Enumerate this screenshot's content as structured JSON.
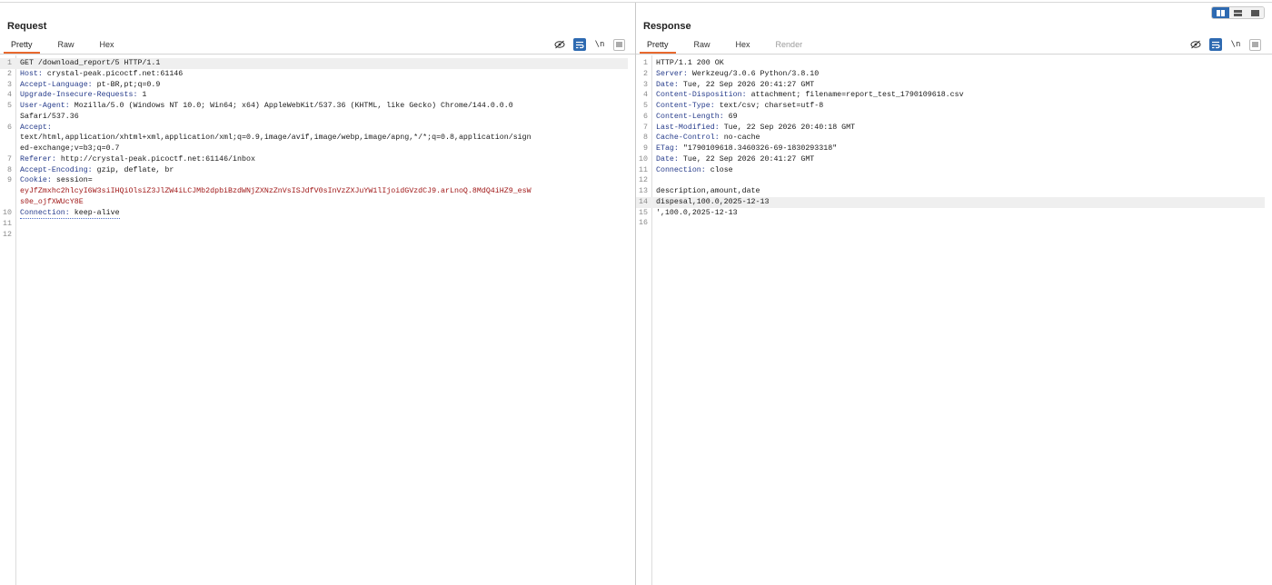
{
  "request": {
    "title": "Request",
    "tabs": [
      "Pretty",
      "Raw",
      "Hex"
    ],
    "lines": [
      {
        "num": "1",
        "text": "GET /download_report/5 HTTP/1.1"
      },
      {
        "num": "2",
        "key": "Host:",
        "value": " crystal-peak.picoctf.net:61146"
      },
      {
        "num": "3",
        "key": "Accept-Language:",
        "value": " pt-BR,pt;q=0.9"
      },
      {
        "num": "4",
        "key": "Upgrade-Insecure-Requests:",
        "value": " 1"
      },
      {
        "num": "5",
        "key": "User-Agent:",
        "value": " Mozilla/5.0 (Windows NT 10.0; Win64; x64) AppleWebKit/537.36 (KHTML, like Gecko) Chrome/144.0.0.0"
      },
      {
        "num": "",
        "text": "Safari/537.36"
      },
      {
        "num": "6",
        "key": "Accept:",
        "value": ""
      },
      {
        "num": "",
        "text": "text/html,application/xhtml+xml,application/xml;q=0.9,image/avif,image/webp,image/apng,*/*;q=0.8,application/sign"
      },
      {
        "num": "",
        "text": "ed-exchange;v=b3;q=0.7"
      },
      {
        "num": "7",
        "key": "Referer:",
        "value": " http://crystal-peak.picoctf.net:61146/inbox"
      },
      {
        "num": "8",
        "key": "Accept-Encoding:",
        "value": " gzip, deflate, br"
      },
      {
        "num": "9",
        "key": "Cookie:",
        "value": " session="
      },
      {
        "num": "",
        "red": "eyJfZmxhc2hlcyI6W3siIHQiOlsiZ3JlZW4iLCJMb2dpbiBzdWNjZXNzZnVsISJdfV0sInVzZXJuYW1lIjoidGVzdCJ9.arLnoQ.8MdQ4iHZ9_esW"
      },
      {
        "num": "",
        "red": "s0e_ojfXWUcY8E"
      },
      {
        "num": "10",
        "key": "Connection:",
        "value": " keep-alive"
      },
      {
        "num": "11",
        "text": ""
      },
      {
        "num": "12",
        "text": ""
      }
    ]
  },
  "response": {
    "title": "Response",
    "tabs": [
      "Pretty",
      "Raw",
      "Hex",
      "Render"
    ],
    "lines": [
      {
        "num": "1",
        "text": "HTTP/1.1 200 OK"
      },
      {
        "num": "2",
        "key": "Server:",
        "value": " Werkzeug/3.0.6 Python/3.8.10"
      },
      {
        "num": "3",
        "key": "Date:",
        "value": " Tue, 22 Sep 2026 20:41:27 GMT"
      },
      {
        "num": "4",
        "key": "Content-Disposition:",
        "value": " attachment; filename=report_test_1790109618.csv"
      },
      {
        "num": "5",
        "key": "Content-Type:",
        "value": " text/csv; charset=utf-8"
      },
      {
        "num": "6",
        "key": "Content-Length:",
        "value": " 69"
      },
      {
        "num": "7",
        "key": "Last-Modified:",
        "value": " Tue, 22 Sep 2026 20:40:18 GMT"
      },
      {
        "num": "8",
        "key": "Cache-Control:",
        "value": " no-cache"
      },
      {
        "num": "9",
        "key": "ETag:",
        "value": " \"1790109618.3460326-69-1830293318\""
      },
      {
        "num": "10",
        "key": "Date:",
        "value": " Tue, 22 Sep 2026 20:41:27 GMT"
      },
      {
        "num": "11",
        "key": "Connection:",
        "value": " close"
      },
      {
        "num": "12",
        "text": ""
      },
      {
        "num": "13",
        "text": "description,amount,date"
      },
      {
        "num": "14",
        "text": "dispesal,100.0,2025-12-13"
      },
      {
        "num": "15",
        "text": "',100.0,2025-12-13"
      },
      {
        "num": "16",
        "text": ""
      }
    ]
  },
  "icons": {
    "hide": "eye-off-icon",
    "wrap": "word-wrap-icon",
    "newline": "\\n",
    "menu": "menu-icon"
  }
}
